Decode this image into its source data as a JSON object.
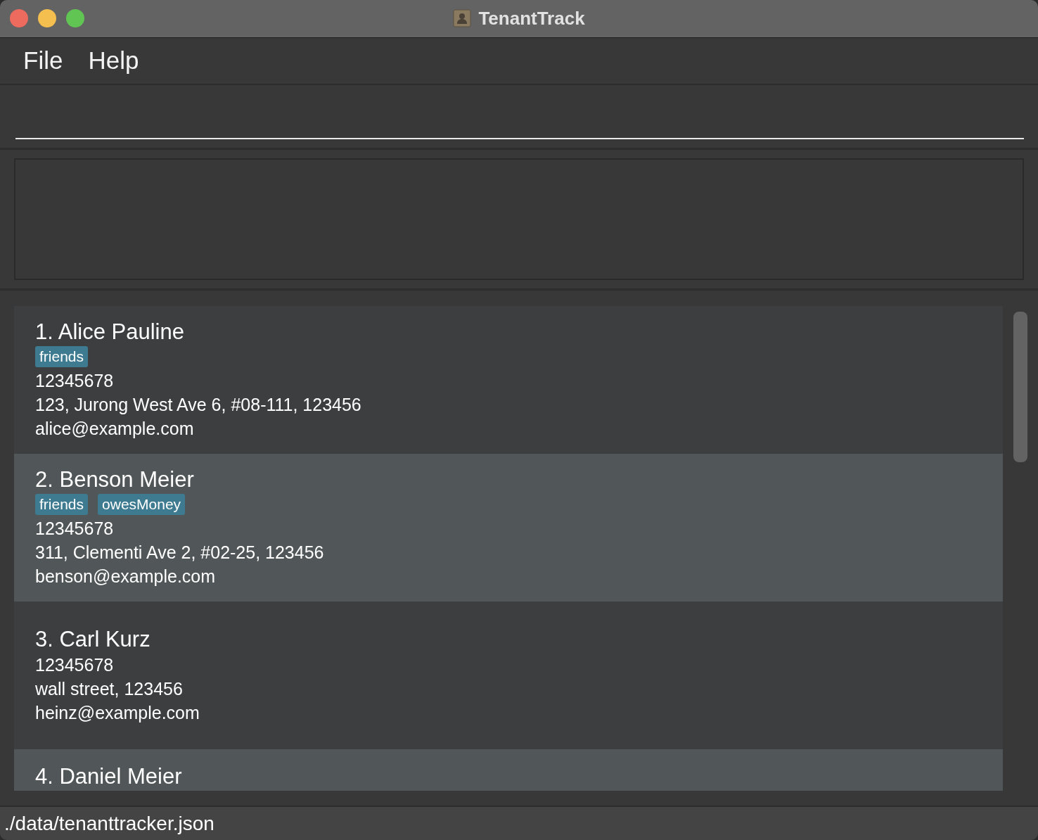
{
  "window": {
    "title": "TenantTrack"
  },
  "menu": [
    "File",
    "Help"
  ],
  "persons": [
    {
      "index": "1.",
      "name": "Alice Pauline",
      "tags": [
        "friends"
      ],
      "phone": "12345678",
      "address": "123, Jurong West Ave 6, #08-111, 123456",
      "email": "alice@example.com"
    },
    {
      "index": "2.",
      "name": "Benson Meier",
      "tags": [
        "friends",
        "owesMoney"
      ],
      "phone": "12345678",
      "address": "311, Clementi Ave 2, #02-25, 123456",
      "email": "benson@example.com"
    },
    {
      "index": "3.",
      "name": "Carl Kurz",
      "phone": "12345678",
      "address": "wall street, 123456",
      "email": "heinz@example.com"
    },
    {
      "index": "4.",
      "name": "Daniel Meier"
    }
  ],
  "status_bar": {
    "path": "./data/tenanttracker.json"
  }
}
